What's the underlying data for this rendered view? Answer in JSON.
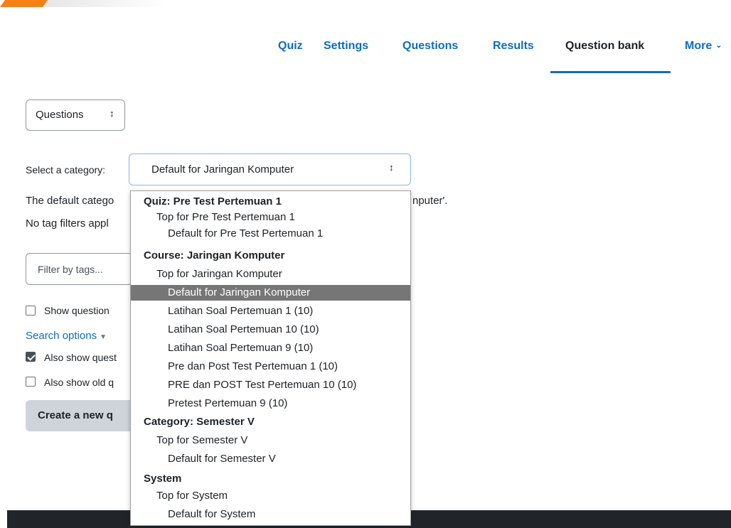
{
  "nav": {
    "tabs": [
      {
        "label": "Quiz"
      },
      {
        "label": "Settings"
      },
      {
        "label": "Questions"
      },
      {
        "label": "Results"
      },
      {
        "label": "Question bank"
      },
      {
        "label": "More"
      }
    ]
  },
  "questions_select": {
    "value": "Questions"
  },
  "category": {
    "label": "Select a category:",
    "selected": "Default for Jaringan Komputer"
  },
  "info": {
    "default_category_prefix": "The default catego",
    "default_category_suffix": "nputer'.",
    "no_tag_prefix": "No tag filters appl"
  },
  "filter": {
    "placeholder": "Filter by tags..."
  },
  "options": {
    "show_question_text": "Show question",
    "search_options": "Search options",
    "also_show_subcats": "Also show quest",
    "also_show_old": "Also show old q"
  },
  "create_button": "Create a new q",
  "dropdown": {
    "items": [
      {
        "label": "Quiz: Pre Test Pertemuan 1",
        "type": "group"
      },
      {
        "label": "Top for Pre Test Pertemuan 1",
        "type": "lv1"
      },
      {
        "label": "Default for Pre Test Pertemuan 1",
        "type": "lv2"
      },
      {
        "label": "Course: Jaringan Komputer",
        "type": "group"
      },
      {
        "label": "Top for Jaringan Komputer",
        "type": "lv1"
      },
      {
        "label": "Default for Jaringan Komputer",
        "type": "lv2",
        "selected": true
      },
      {
        "label": "Latihan Soal Pertemuan 1 (10)",
        "type": "lv2"
      },
      {
        "label": "Latihan Soal Pertemuan 10 (10)",
        "type": "lv2"
      },
      {
        "label": "Latihan Soal Pertemuan 9 (10)",
        "type": "lv2"
      },
      {
        "label": "Pre dan Post Test Pertemuan 1 (10)",
        "type": "lv2"
      },
      {
        "label": "PRE dan POST Test Pertemuan 10 (10)",
        "type": "lv2"
      },
      {
        "label": "Pretest Pertemuan 9 (10)",
        "type": "lv2"
      },
      {
        "label": "Category: Semester V",
        "type": "group"
      },
      {
        "label": "Top for Semester V",
        "type": "lv1"
      },
      {
        "label": "Default for Semester V",
        "type": "lv2"
      },
      {
        "label": "System",
        "type": "group"
      },
      {
        "label": "Top for System",
        "type": "lv1"
      },
      {
        "label": "Default for System",
        "type": "lv2"
      }
    ]
  },
  "colors": {
    "link": "#0f6cbf",
    "selected_bg": "#767676",
    "footer": "#212529"
  }
}
